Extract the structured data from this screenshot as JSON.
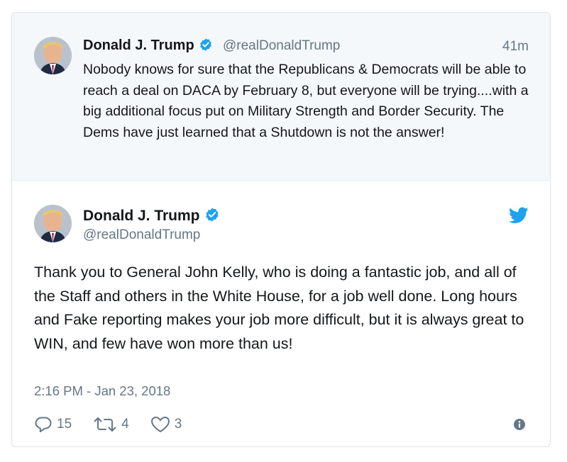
{
  "quoted_tweet": {
    "name": "Donald J. Trump",
    "handle": "@realDonaldTrump",
    "time": "41m",
    "text": "Nobody knows for sure that the Republicans & Democrats will be able to reach a deal on DACA by February 8, but everyone will be trying....with a big additional focus put on Military Strength and Border Security. The Dems have just learned that a Shutdown is not the answer!"
  },
  "tweet": {
    "name": "Donald J. Trump",
    "handle": "@realDonaldTrump",
    "text": "Thank you to General John Kelly, who is doing a fantastic job, and all of the Staff and others in the White House, for a job well done. Long hours and Fake reporting makes your job more difficult, but it is always great to WIN, and few have won more than us!",
    "date": "2:16 PM - Jan 23, 2018",
    "replies": "15",
    "retweets": "4",
    "likes": "3"
  },
  "icons": {
    "verified": "verified-badge-icon",
    "bird": "twitter-bird-icon",
    "reply": "reply-icon",
    "retweet": "retweet-icon",
    "like": "heart-icon",
    "info": "info-icon"
  },
  "colors": {
    "brand": "#1da1f2",
    "secondary_text": "#657786",
    "quoted_bg": "#f5f8fa"
  }
}
